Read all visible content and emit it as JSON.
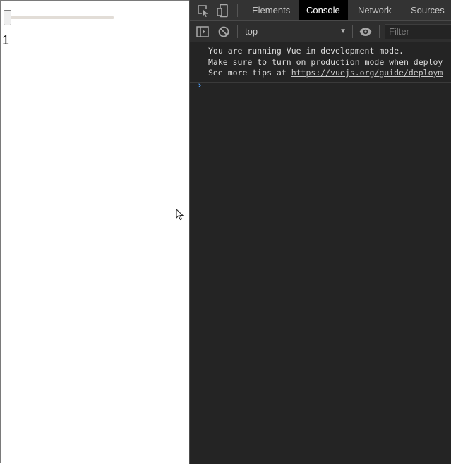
{
  "page": {
    "slider_value": "1"
  },
  "devtools": {
    "tabs": [
      {
        "label": "Elements"
      },
      {
        "label": "Console"
      },
      {
        "label": "Network"
      },
      {
        "label": "Sources"
      }
    ],
    "active_tab": "Console",
    "toolbar": {
      "context": "top",
      "filter_placeholder": "Filter"
    },
    "console": {
      "message_lines": [
        "You are running Vue in development mode.",
        "Make sure to turn on production mode when deploy",
        "See more tips at "
      ],
      "link_text": "https://vuejs.org/guide/deploym"
    }
  },
  "icons": {
    "inspect": "inspect-element-icon",
    "device": "device-toolbar-icon",
    "sidebar": "console-sidebar-icon",
    "clear": "clear-console-icon",
    "eye": "live-expression-eye-icon",
    "prompt": "console-prompt-chevron-icon",
    "cursor": "mouse-cursor-icon"
  },
  "colors": {
    "devtools_bg": "#242424",
    "tabbar_bg": "#333333",
    "active_tab_bg": "#000000",
    "prompt_blue": "#4d9cf4",
    "slider_track": "#e2ddd7"
  }
}
